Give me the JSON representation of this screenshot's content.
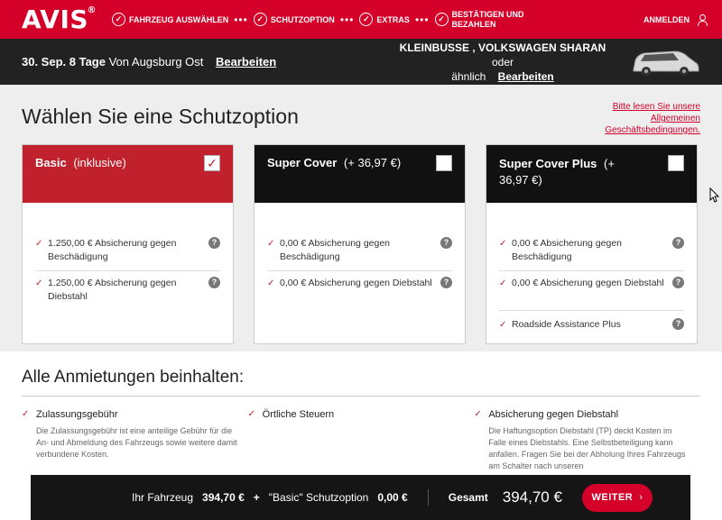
{
  "header": {
    "logo": "AVIS",
    "logo_reg": "®",
    "steps": [
      {
        "label": "FAHRZEUG AUSWÄHLEN"
      },
      {
        "label": "SCHUTZOPTION"
      },
      {
        "label": "EXTRAS"
      },
      {
        "label_line1": "BESTÄTIGEN UND",
        "label_line2": "BEZAHLEN"
      }
    ],
    "dots": "•••",
    "login": "ANMELDEN"
  },
  "trip": {
    "dates": "30. Sep. 8 Tage",
    "location": "Von Augsburg Ost",
    "edit": "Bearbeiten",
    "car_name": "KLEINBUSSE , VOLKSWAGEN SHARAN",
    "car_suffix": "oder",
    "car_line2": "ähnlich",
    "car_edit": "Bearbeiten"
  },
  "options": {
    "title": "Wählen Sie eine Schutzoption",
    "terms": "Bitte lesen Sie unsere Allgemeinen Geschäftsbedingungen.",
    "cards": [
      {
        "name": "Basic",
        "price": "(inklusive)",
        "features": [
          "1.250,00 € Absicherung gegen Beschädigung",
          "1.250,00 € Absicherung gegen Diebstahl"
        ]
      },
      {
        "name": "Super Cover",
        "price": "(+ 36,97 €)",
        "features": [
          "0,00 € Absicherung gegen Beschädigung",
          "0,00 € Absicherung gegen Diebstahl"
        ]
      },
      {
        "name": "Super Cover Plus",
        "price": "(+",
        "price_line2": "36,97 €)",
        "features": [
          "0,00 € Absicherung gegen Beschädigung",
          "0,00 € Absicherung gegen Diebstahl",
          "Roadside Assistance Plus"
        ]
      }
    ],
    "check_glyph": "✓",
    "help_glyph": "?"
  },
  "inclusions": {
    "title": "Alle Anmietungen beinhalten:",
    "items": [
      {
        "name": "Zulassungsgebühr",
        "desc": "Die Zulassungsgebühr ist eine anteilige Gebühr für die An- und Abmeldung des Fahrzeugs sowie weitere damit verbundene Kosten."
      },
      {
        "name": "Örtliche Steuern",
        "desc": ""
      },
      {
        "name": "Absicherung gegen Diebstahl",
        "desc": "Die Haftungsoption Diebstahl (TP) deckt Kosten im Falle eines Diebstahls. Eine Selbstbeteiligung kann anfallen. Fragen Sie bei der Abholung Ihres Fahrzeugs am Schalter nach unseren"
      }
    ]
  },
  "total": {
    "vehicle_label": "Ihr Fahrzeug",
    "vehicle_price": "394,70 €",
    "plus": "+",
    "protection_label": "\"Basic\" Schutzoption",
    "protection_price": "0,00 €",
    "sum_label": "Gesamt",
    "sum_value": "394,70 €",
    "next_button": "WEITER"
  },
  "colors": {
    "brand_red": "#d4002a",
    "card_red": "#c1212c",
    "dark": "#111111"
  }
}
